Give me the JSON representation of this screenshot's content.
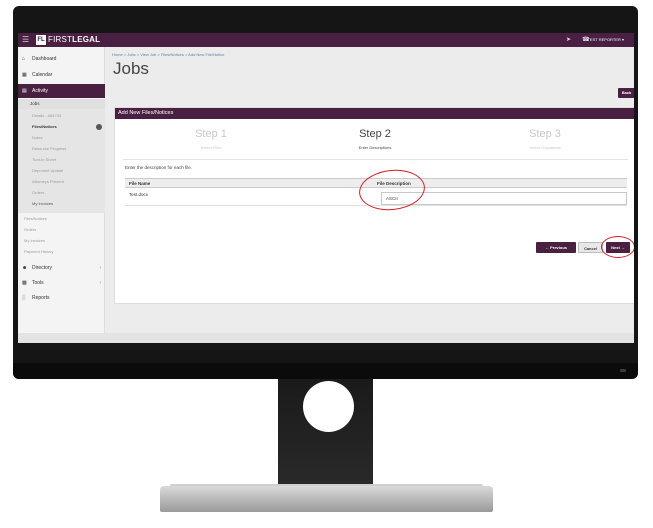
{
  "app": {
    "logo_mark": "FL",
    "brand_first": "FIRST",
    "brand_second": "LEGAL",
    "user_menu": "TEST REPORTER ▾"
  },
  "sidebar": {
    "items": [
      {
        "label": "Dashboard",
        "icon": "home-icon"
      },
      {
        "label": "Calendar",
        "icon": "calendar-icon"
      },
      {
        "label": "Activity",
        "icon": "folder-icon"
      },
      {
        "label": "Directory",
        "icon": "people-icon"
      },
      {
        "label": "Tools",
        "icon": "tools-icon"
      },
      {
        "label": "Reports",
        "icon": "chart-icon"
      }
    ],
    "jobs_label": "Jobs",
    "job_subitems": [
      "Details - #54733",
      "Files/Notices",
      "Notes",
      "Resource Progress",
      "Turn-in Sheet",
      "Deponent Update",
      "Attorneys Present",
      "Orders",
      "My Invoices"
    ],
    "activity_subitems": [
      "Files/Notices",
      "Orders",
      "My Invoices",
      "Payment History"
    ]
  },
  "main": {
    "breadcrumb": "Home > Jobs > View Job > Files/Notices > Add New File/Notice",
    "page_title": "Jobs",
    "back_label": "Back",
    "panel_title": "Add New Files/Notices",
    "steps": [
      {
        "num": "Step 1",
        "label": "Select Files"
      },
      {
        "num": "Step 2",
        "label": "Enter Descriptions"
      },
      {
        "num": "Step 3",
        "label": "Select Deponents"
      }
    ],
    "instruction": "Enter the description for each file.",
    "table": {
      "headers": [
        "File Name",
        "File Description"
      ],
      "rows": [
        {
          "file_name": "Test.docx",
          "description": "ASCII"
        }
      ]
    },
    "buttons": {
      "previous": "← Previous",
      "cancel": "Cancel",
      "next": "Next →"
    }
  },
  "colors": {
    "brand": "#4a2042",
    "annotation": "#d21d25"
  }
}
